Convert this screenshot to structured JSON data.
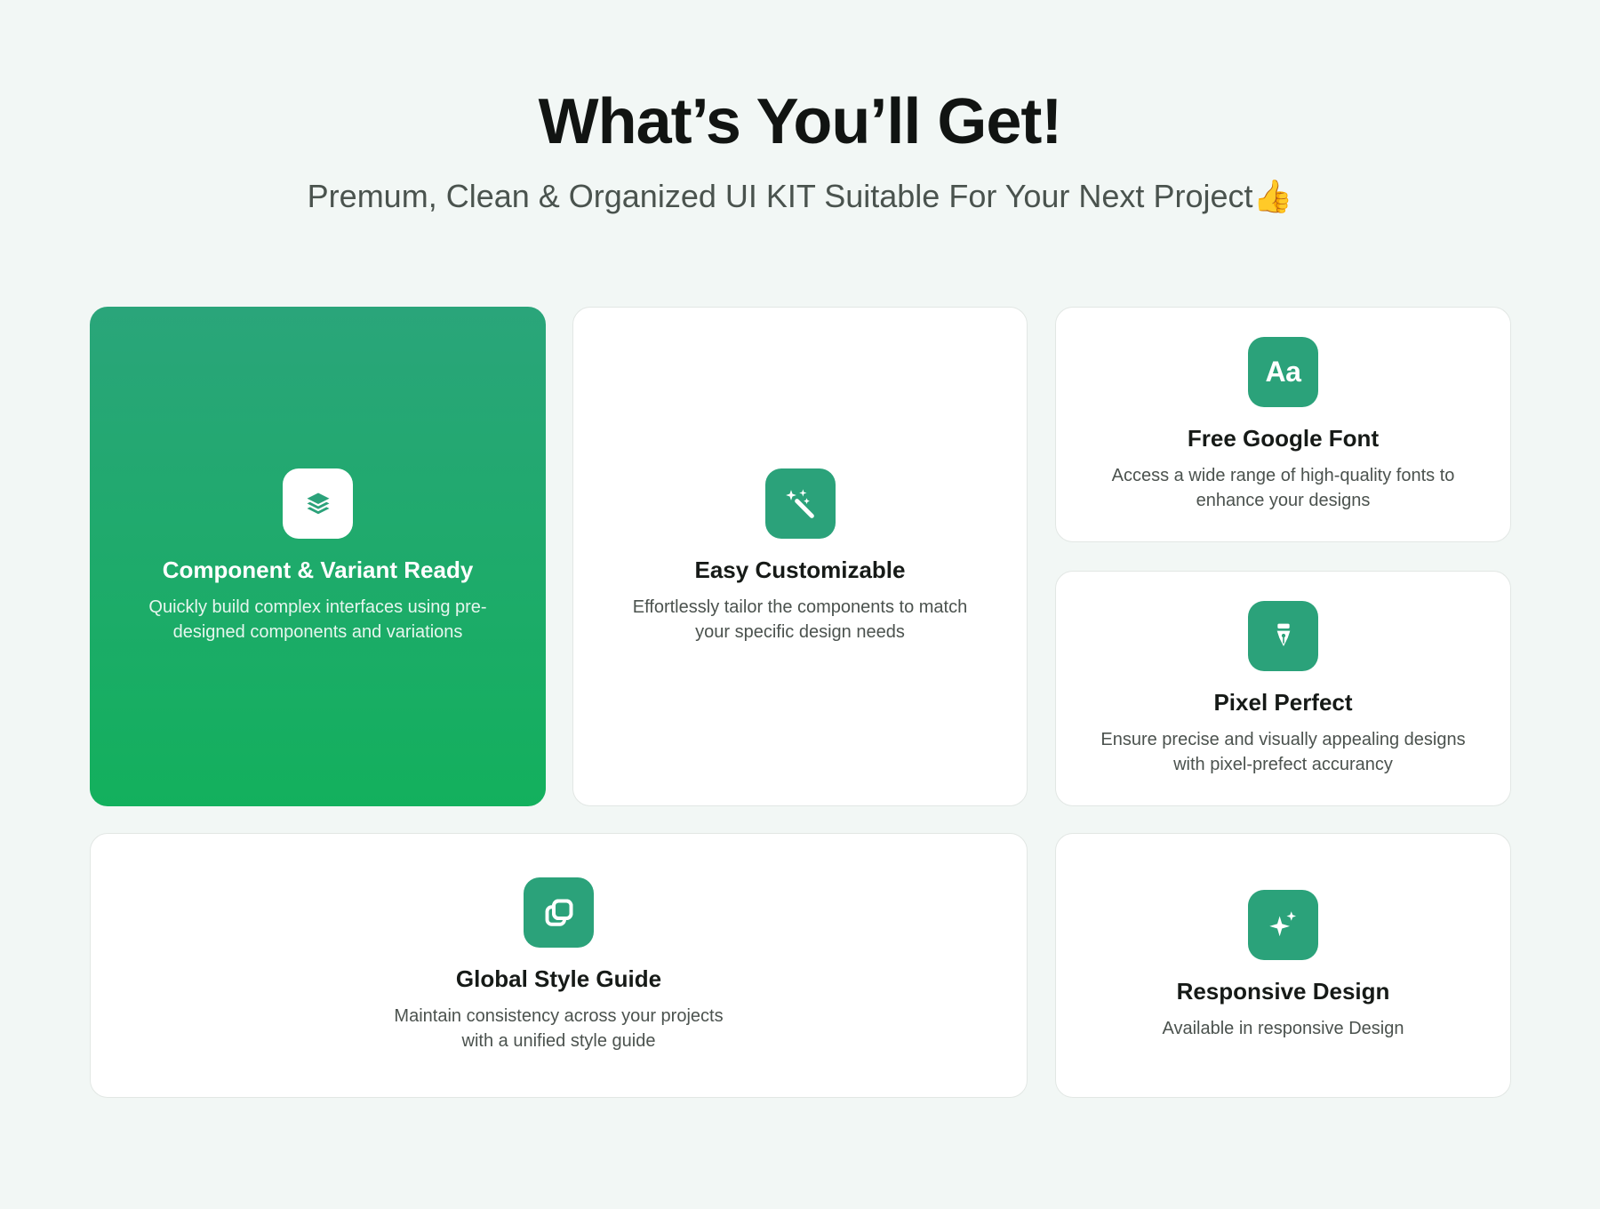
{
  "header": {
    "title": "What’s You’ll Get!",
    "subtitle": "Premum, Clean & Organized UI KIT Suitable For Your Next Project👍"
  },
  "colors": {
    "accent": "#2ba27a",
    "featured_gradient_top": "#2aa57a",
    "featured_gradient_bottom": "#13b05d",
    "background": "#f2f7f5",
    "card": "#ffffff"
  },
  "features": [
    {
      "icon": "layers-icon",
      "title": "Component & Variant Ready",
      "description": "Quickly build complex interfaces using pre-designed components and variations",
      "highlighted": true
    },
    {
      "icon": "magic-wand-icon",
      "title": "Easy Customizable",
      "description": "Effortlessly tailor the components to match your specific design needs"
    },
    {
      "icon": "font-icon",
      "icon_text": "Aa",
      "title": "Free Google Font",
      "description": "Access a wide range of high-quality fonts to enhance your designs"
    },
    {
      "icon": "pen-tool-icon",
      "title": "Pixel Perfect",
      "description": "Ensure precise and visually appealing designs with pixel-prefect accurancy"
    },
    {
      "icon": "style-guide-icon",
      "title": "Global Style Guide",
      "description": "Maintain consistency across your projects with a unified style guide"
    },
    {
      "icon": "sparkle-icon",
      "title": "Responsive Design",
      "description": "Available in responsive Design"
    }
  ]
}
